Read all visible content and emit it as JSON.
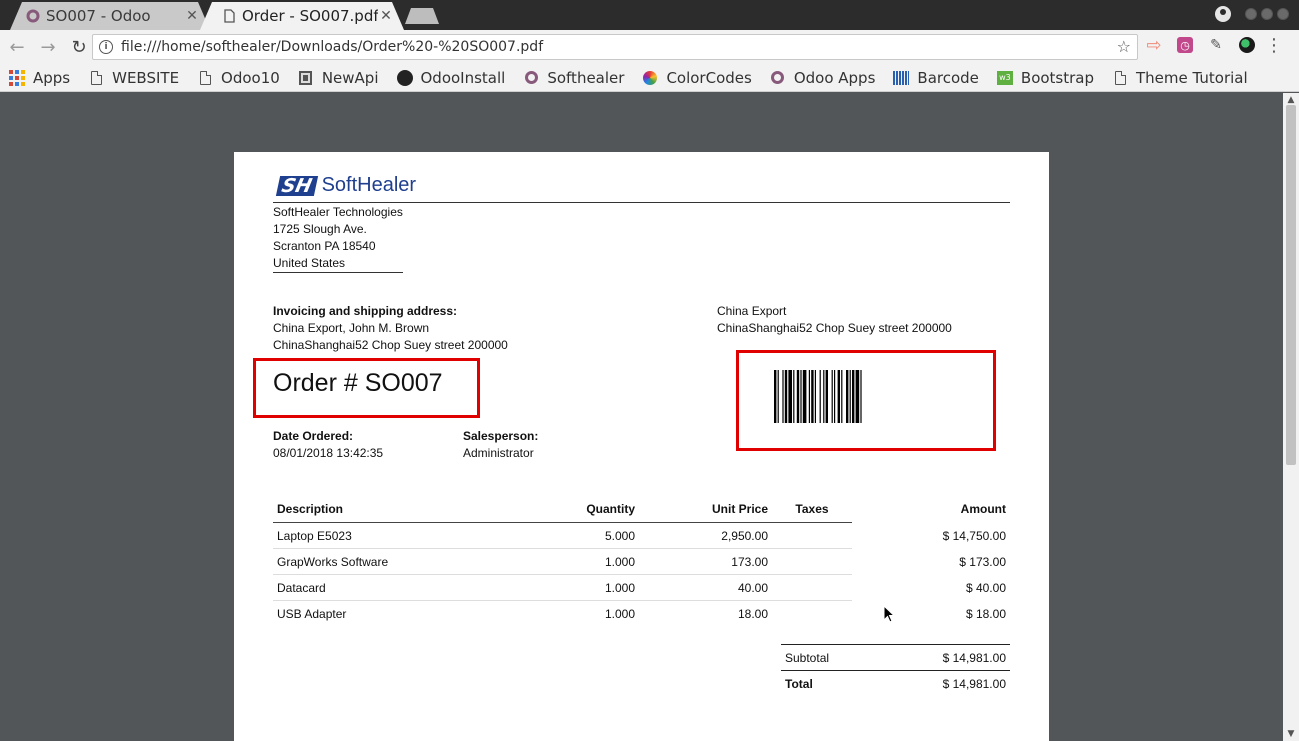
{
  "browser": {
    "tabs": [
      {
        "title": "SO007 - Odoo",
        "active": false
      },
      {
        "title": "Order - SO007.pdf",
        "active": true
      }
    ],
    "url": "file:///home/softhealer/Downloads/Order%20-%20SO007.pdf",
    "bookmarks": [
      {
        "label": "Apps",
        "icon": "apps-grid-icon"
      },
      {
        "label": "WEBSITE",
        "icon": "page-icon"
      },
      {
        "label": "Odoo10",
        "icon": "page-icon"
      },
      {
        "label": "NewApi",
        "icon": "book-icon"
      },
      {
        "label": "OdooInstall",
        "icon": "github-icon"
      },
      {
        "label": "Softhealer",
        "icon": "odoo-icon"
      },
      {
        "label": "ColorCodes",
        "icon": "color-wheel-icon"
      },
      {
        "label": "Odoo Apps",
        "icon": "odoo-icon"
      },
      {
        "label": "Barcode",
        "icon": "barcode-icon"
      },
      {
        "label": "Bootstrap",
        "icon": "bootstrap-icon"
      },
      {
        "label": "Theme Tutorial",
        "icon": "page-icon"
      }
    ]
  },
  "document": {
    "logo": {
      "mark": "SH",
      "text": "SoftHealer"
    },
    "company": {
      "name": "SoftHealer Technologies",
      "street": "1725 Slough Ave.",
      "city": "Scranton PA 18540",
      "country": "United States"
    },
    "invoicing": {
      "label": "Invoicing and shipping address:",
      "line1": "China Export, John M. Brown",
      "line2": "ChinaShanghai52 Chop Suey street 200000"
    },
    "partner": {
      "line1": "China Export",
      "line2": "ChinaShanghai52 Chop Suey street 200000"
    },
    "order_title": "Order # SO007",
    "date_label": "Date Ordered:",
    "date_value": "08/01/2018 13:42:35",
    "salesperson_label": "Salesperson:",
    "salesperson_value": "Administrator",
    "table": {
      "headers": [
        "Description",
        "Quantity",
        "Unit Price",
        "Taxes",
        "Amount"
      ],
      "rows": [
        [
          "Laptop E5023",
          "5.000",
          "2,950.00",
          "",
          "$ 14,750.00"
        ],
        [
          "GrapWorks Software",
          "1.000",
          "173.00",
          "",
          "$ 173.00"
        ],
        [
          "Datacard",
          "1.000",
          "40.00",
          "",
          "$ 40.00"
        ],
        [
          "USB Adapter",
          "1.000",
          "18.00",
          "",
          "$ 18.00"
        ]
      ]
    },
    "totals": {
      "subtotal_label": "Subtotal",
      "subtotal_value": "$ 14,981.00",
      "total_label": "Total",
      "total_value": "$ 14,981.00"
    }
  },
  "colors": {
    "highlight": "#e00000",
    "brand": "#1f3f8f",
    "odoo": "#875a7b"
  }
}
